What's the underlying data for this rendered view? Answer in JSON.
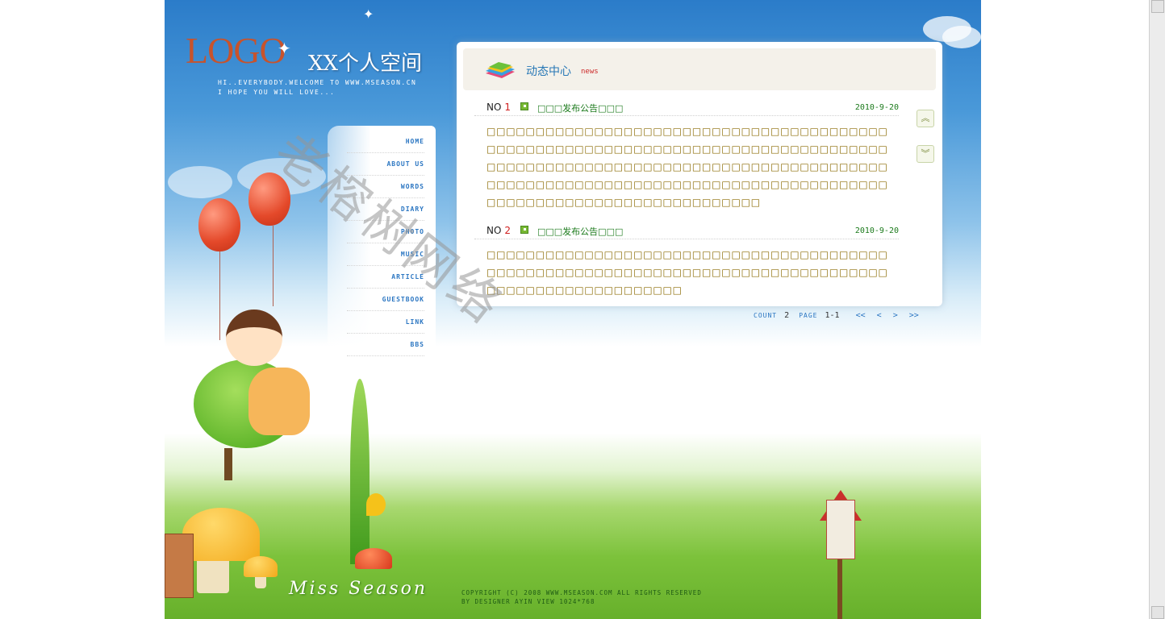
{
  "header": {
    "logo": "LOGO",
    "title": "XX个人空间",
    "tagline_line1": "HI..EVERYBODY.WELCOME TO WWW.MSEASON.CN",
    "tagline_line2": "I HOPE YOU WILL LOVE..."
  },
  "nav": {
    "items": [
      {
        "label": "HOME"
      },
      {
        "label": "ABOUT US"
      },
      {
        "label": "WORDS"
      },
      {
        "label": "DIARY"
      },
      {
        "label": "PHOTO"
      },
      {
        "label": "MUSIC"
      },
      {
        "label": "ARTICLE"
      },
      {
        "label": "GUESTBOOK"
      },
      {
        "label": "LINK"
      },
      {
        "label": "BBS"
      }
    ]
  },
  "main": {
    "title": "动态中心",
    "subtitle": "news",
    "news": [
      {
        "no_label": "NO",
        "number": "1",
        "title": "□□□发布公告□□□",
        "date": "2010-9-20",
        "body": "□□□□□□□□□□□□□□□□□□□□□□□□□□□□□□□□□□□□□□□□□□□□□□□□□□□□□□□□□□□□□□□□□□□□□□□□□□□□□□□□□□□□□□□□□□□□□□□□□□□□□□□□□□□□□□□□□□□□□□□□□□□□□□□□□□□□□□□□□□□□□□□□□□□□□□□□□□□□□□□□□□□□□□□□□□□□□□□□□□□□□□□□□□□□□□□□"
      },
      {
        "no_label": "NO",
        "number": "2",
        "title": "□□□发布公告□□□",
        "date": "2010-9-20",
        "body": "□□□□□□□□□□□□□□□□□□□□□□□□□□□□□□□□□□□□□□□□□□□□□□□□□□□□□□□□□□□□□□□□□□□□□□□□□□□□□□□□□□□□□□□□□□□□□□□□□□□□□□"
      }
    ],
    "pager": {
      "count_label": "COUNT",
      "count": "2",
      "page_label": "PAGE",
      "page": "1-1",
      "first": "<<",
      "prev": "<",
      "next": ">",
      "last": ">>"
    }
  },
  "watermark": "老榕树网络",
  "footer": {
    "signature": "Miss Season",
    "copyright_line1": "COPYRIGHT (C) 2008 WWW.MSEASON.COM ALL RIGHTS RESERVED",
    "copyright_line2": "BY DESIGNER AYIN VIEW 1024*768"
  },
  "icons": {
    "scroll_up": "double-chevron-up-icon",
    "scroll_down": "double-chevron-down-icon",
    "news_bullet": "green-square-bullet-icon",
    "header_icon": "colorful-books-icon"
  },
  "colors": {
    "sky": "#2b7cc9",
    "grass": "#67b02b",
    "logo": "#c7532c",
    "nav_text": "#2b76c2",
    "news_title": "#1b7a1b",
    "news_number": "#d01e1e",
    "body_text": "#8a6a00"
  }
}
